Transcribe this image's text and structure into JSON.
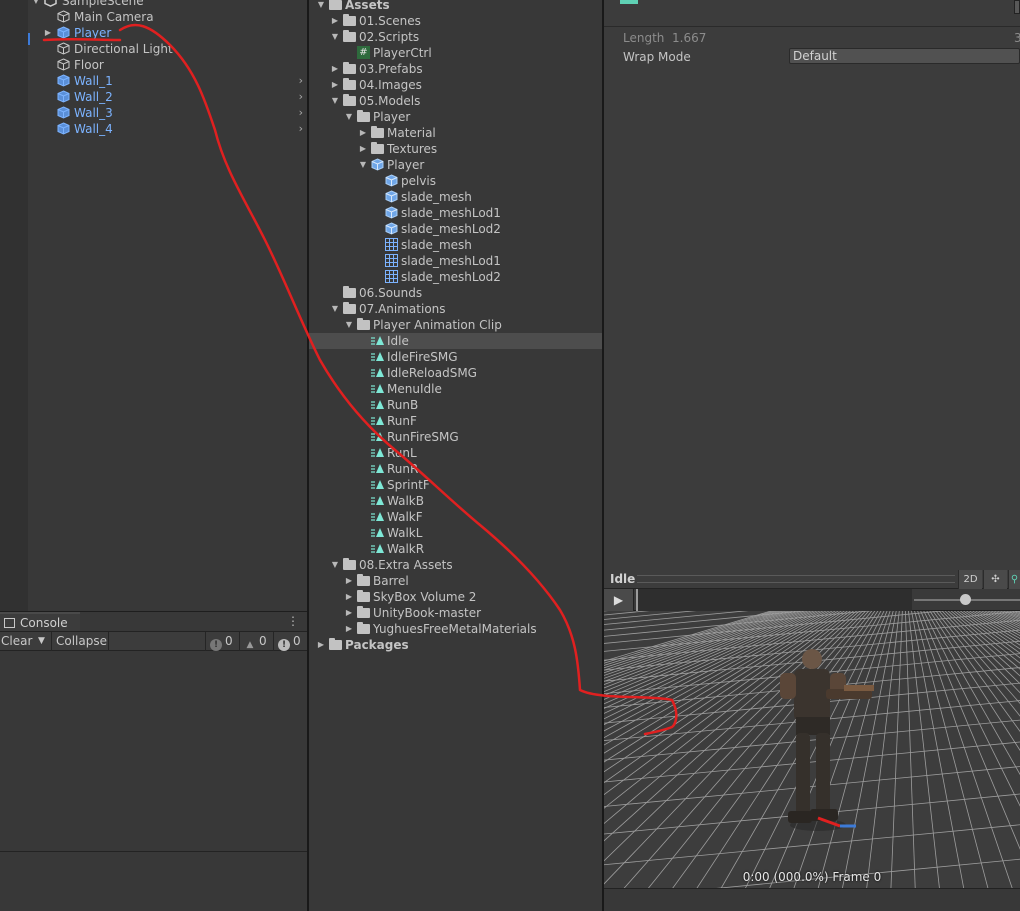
{
  "hierarchy": {
    "scene_label": "SampleScene",
    "items": [
      {
        "label": "Main Camera",
        "prefab": false
      },
      {
        "label": "Player",
        "prefab": true
      },
      {
        "label": "Directional Light",
        "prefab": false
      },
      {
        "label": "Floor",
        "prefab": false
      },
      {
        "label": "Wall_1",
        "prefab": true
      },
      {
        "label": "Wall_2",
        "prefab": true
      },
      {
        "label": "Wall_3",
        "prefab": true
      },
      {
        "label": "Wall_4",
        "prefab": true
      }
    ]
  },
  "console": {
    "title": "Console",
    "clear_label": "Clear",
    "collapse_label": "Collapse",
    "info_count": "0",
    "warning_count": "0",
    "error_count": "0"
  },
  "project": {
    "items": [
      {
        "label": "Assets",
        "type": "folder",
        "expanded": true
      },
      {
        "label": "01.Scenes",
        "type": "folder",
        "expanded": false
      },
      {
        "label": "02.Scripts",
        "type": "folder",
        "expanded": true
      },
      {
        "label": "PlayerCtrl",
        "type": "script"
      },
      {
        "label": "03.Prefabs",
        "type": "folder",
        "expanded": false
      },
      {
        "label": "04.Images",
        "type": "folder",
        "expanded": false
      },
      {
        "label": "05.Models",
        "type": "folder",
        "expanded": true
      },
      {
        "label": "Player",
        "type": "folder",
        "expanded": true
      },
      {
        "label": "Material",
        "type": "folder",
        "expanded": false
      },
      {
        "label": "Textures",
        "type": "folder",
        "expanded": false
      },
      {
        "label": "Player",
        "type": "model",
        "expanded": true
      },
      {
        "label": "pelvis",
        "type": "model"
      },
      {
        "label": "slade_mesh",
        "type": "model"
      },
      {
        "label": "slade_meshLod1",
        "type": "model"
      },
      {
        "label": "slade_meshLod2",
        "type": "model"
      },
      {
        "label": "slade_mesh",
        "type": "mesh"
      },
      {
        "label": "slade_meshLod1",
        "type": "mesh"
      },
      {
        "label": "slade_meshLod2",
        "type": "mesh"
      },
      {
        "label": "06.Sounds",
        "type": "folder"
      },
      {
        "label": "07.Animations",
        "type": "folder",
        "expanded": true
      },
      {
        "label": "Player Animation Clip",
        "type": "folder",
        "expanded": true
      },
      {
        "label": "Idle",
        "type": "anim",
        "selected": true
      },
      {
        "label": "IdleFireSMG",
        "type": "anim"
      },
      {
        "label": "IdleReloadSMG",
        "type": "anim"
      },
      {
        "label": "MenuIdle",
        "type": "anim"
      },
      {
        "label": "RunB",
        "type": "anim"
      },
      {
        "label": "RunF",
        "type": "anim"
      },
      {
        "label": "RunFireSMG",
        "type": "anim"
      },
      {
        "label": "RunL",
        "type": "anim"
      },
      {
        "label": "RunR",
        "type": "anim"
      },
      {
        "label": "SprintF",
        "type": "anim"
      },
      {
        "label": "WalkB",
        "type": "anim"
      },
      {
        "label": "WalkF",
        "type": "anim"
      },
      {
        "label": "WalkL",
        "type": "anim"
      },
      {
        "label": "WalkR",
        "type": "anim"
      },
      {
        "label": "08.Extra Assets",
        "type": "folder",
        "expanded": true
      },
      {
        "label": "Barrel",
        "type": "folder",
        "expanded": false
      },
      {
        "label": "SkyBox Volume 2",
        "type": "folder",
        "expanded": false
      },
      {
        "label": "UnityBook-master",
        "type": "folder",
        "expanded": false
      },
      {
        "label": "YughuesFreeMetalMaterials",
        "type": "folder",
        "expanded": false
      },
      {
        "label": "Packages",
        "type": "folder",
        "expanded": false
      }
    ]
  },
  "inspector": {
    "length_label": "Length",
    "length_value": "1.667",
    "length_right": "3",
    "wrap_mode_label": "Wrap Mode",
    "wrap_mode_value": "Default"
  },
  "preview": {
    "title": "Idle",
    "btn_2d": "2D",
    "frame_readout": "0:00 (000.0%) Frame 0",
    "speed_level": 0.48
  },
  "colors": {
    "panel_bg": "#383838",
    "selection": "#4d4d4d",
    "prefab_blue": "#7cb3ff",
    "anim_cyan": "#7ee8d6",
    "annotation_red": "#e02020"
  }
}
